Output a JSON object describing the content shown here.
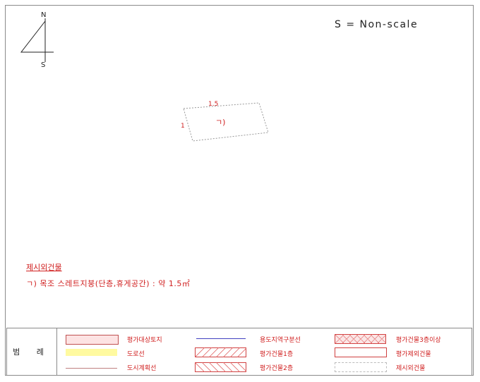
{
  "compass": {
    "north": "N",
    "south": "S"
  },
  "scale_text": "S = Non-scale",
  "drawing": {
    "dim_width": "1.5",
    "dim_height": "1",
    "building_label": "ㄱ)"
  },
  "section": {
    "title": "제시외건물",
    "item": "ㄱ) 목조 스레트지붕(단층,휴게공간) : 약 1.5㎡"
  },
  "legend": {
    "title": "범 례",
    "items": [
      {
        "label": "평가대상토지",
        "color": "#f9d6d6"
      },
      {
        "label": "도로선",
        "color": "#fff9a0"
      },
      {
        "label": "도시계획선",
        "color": "#d08080"
      },
      {
        "label": "용도지역구분선",
        "color": "#4040c0"
      },
      {
        "label": "평가건물1층",
        "color": "#e06060"
      },
      {
        "label": "평가건물2층",
        "color": "#e06060"
      },
      {
        "label": "평가건물3층이상",
        "color": "#e06060"
      },
      {
        "label": "평가제외건물",
        "color": "#e06060"
      },
      {
        "label": "제시외건물",
        "color": "#e06060"
      }
    ]
  }
}
